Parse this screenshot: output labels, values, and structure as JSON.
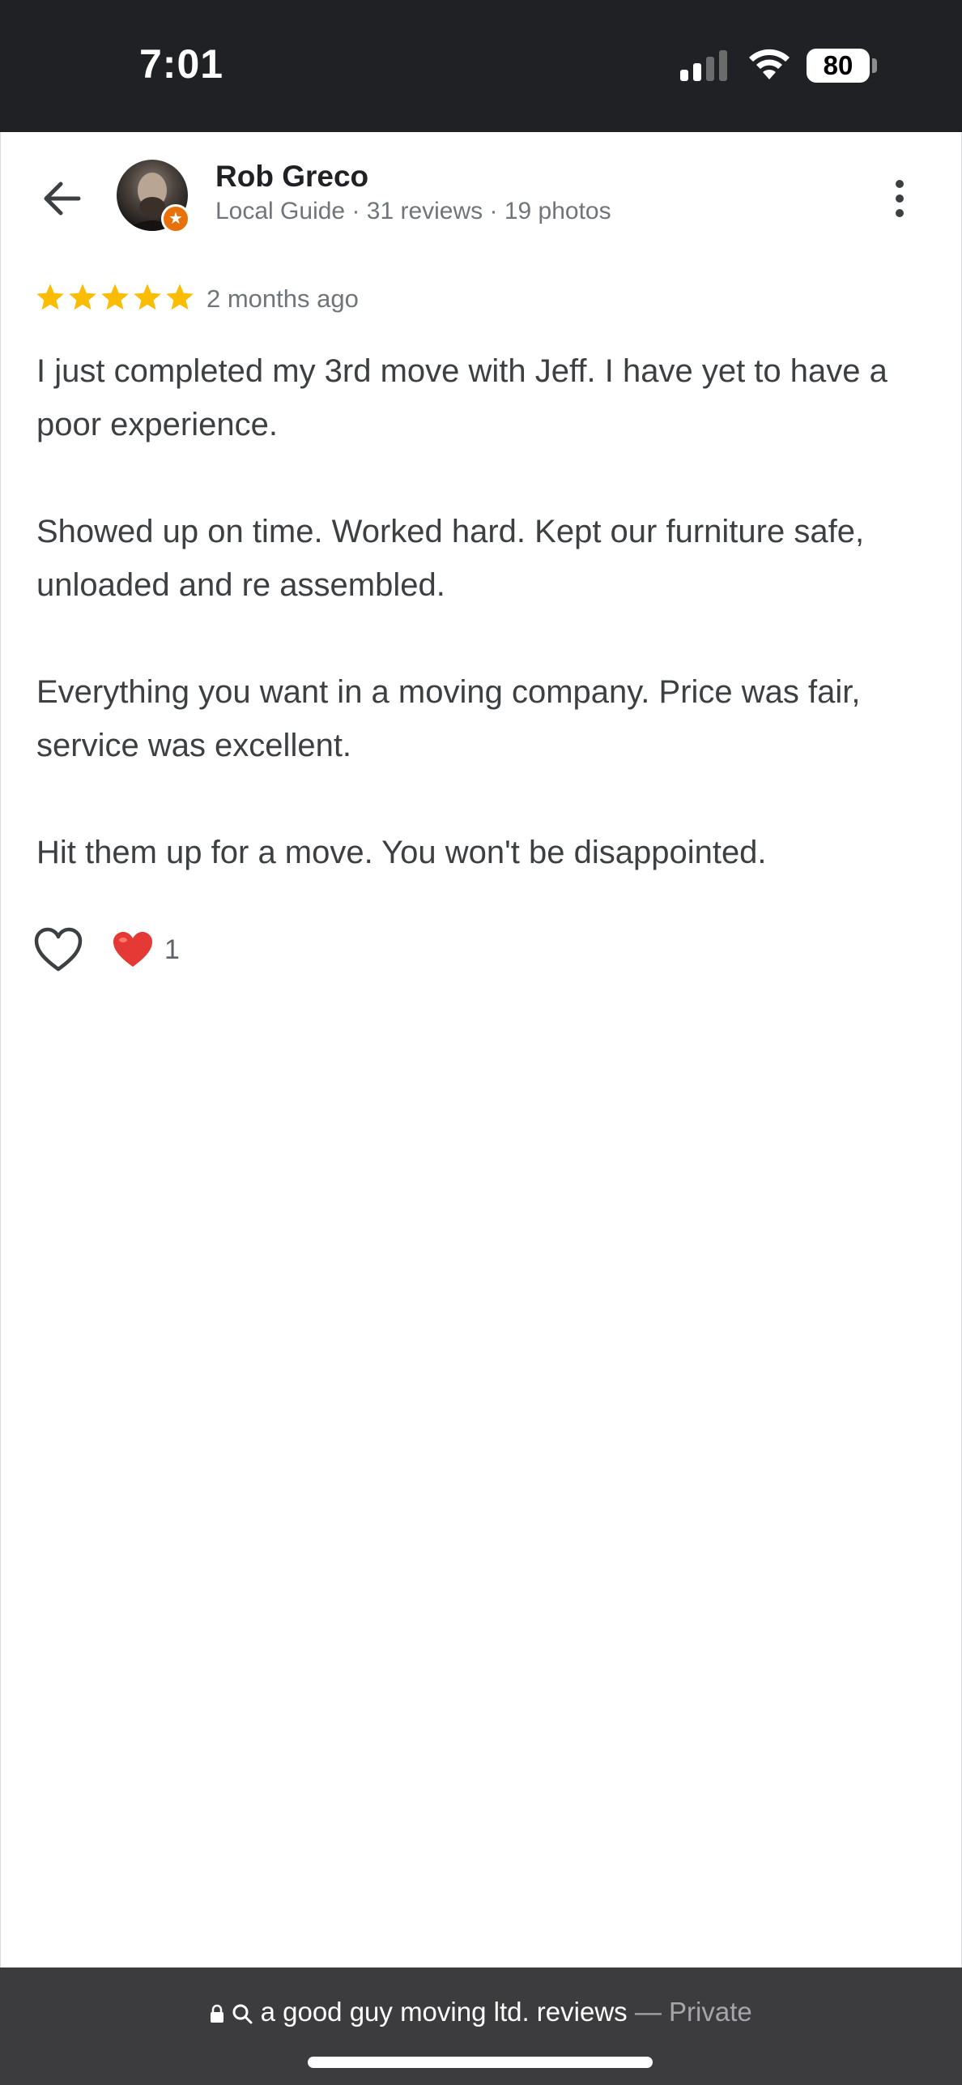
{
  "status_bar": {
    "time": "7:01",
    "battery": "80",
    "icons": [
      "signal-icon",
      "wifi-icon",
      "battery-icon"
    ]
  },
  "review": {
    "reviewer": {
      "name": "Rob Greco",
      "meta": "Local Guide · 31 reviews · 19 photos"
    },
    "rating": 5,
    "rating_max": 5,
    "date": "2 months ago",
    "paragraphs": [
      "I just completed my 3rd move with Jeff. I have yet to have a poor experience.",
      "Showed up on time. Worked hard. Kept our furniture safe, unloaded and re assembled.",
      "Everything you want in a moving company. Price was fair, service was excellent.",
      "Hit them up for a move. You won't be disappointed."
    ],
    "reaction_count": "1"
  },
  "browser_bar": {
    "url_text": "a good guy moving ltd. reviews",
    "separator": "—",
    "mode": "Private"
  },
  "colors": {
    "status_bar_bg": "#202124",
    "star": "#fbbc04",
    "heart": "#e53935",
    "bottom_bar_bg": "#3c3c3e",
    "local_guide_badge": "#e8710a"
  }
}
